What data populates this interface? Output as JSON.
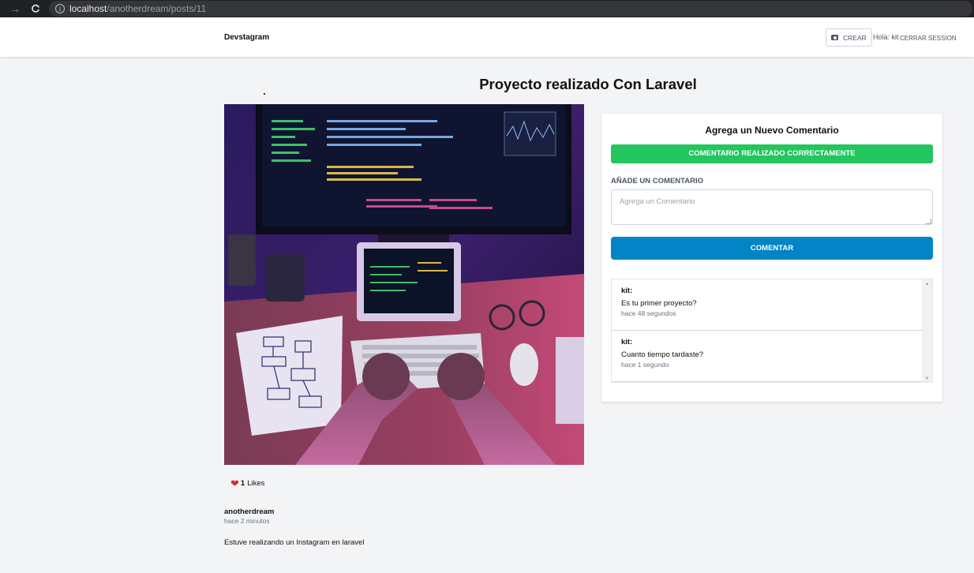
{
  "browser": {
    "url_host": "localhost",
    "url_path": "/anotherdream/posts/11",
    "back_icon": "→",
    "reload_icon": "C"
  },
  "header": {
    "brand": "Devstagram",
    "create_label": "CREAR",
    "greeting": "Hola: kit",
    "logout_label": "CERRAR SESSION"
  },
  "post": {
    "title": "Proyecto realizado Con Laravel",
    "likes_count": "1",
    "likes_label": "Likes",
    "author": "anotherdream",
    "time_ago": "hace 2 minutos",
    "description": "Estuve realizando un Instagram en laravel"
  },
  "comment_form": {
    "heading": "Agrega un Nuevo Comentario",
    "success_message": "COMENTARIO REALIZADO CORRECTAMENTE",
    "field_label": "AÑADE UN COMENTARIO",
    "placeholder": "Agrega un Comentario",
    "submit_label": "COMENTAR"
  },
  "comments": [
    {
      "user": "kit:",
      "text": "Es tu primer proyecto?",
      "time": "hace 48 segundos"
    },
    {
      "user": "kit:",
      "text": "Cuanto tiempo tardaste?",
      "time": "hace 1 segundo"
    }
  ],
  "colors": {
    "success": "#22c55e",
    "primary": "#0284c7",
    "like": "#dc2626",
    "page_bg": "#f3f4f6"
  }
}
